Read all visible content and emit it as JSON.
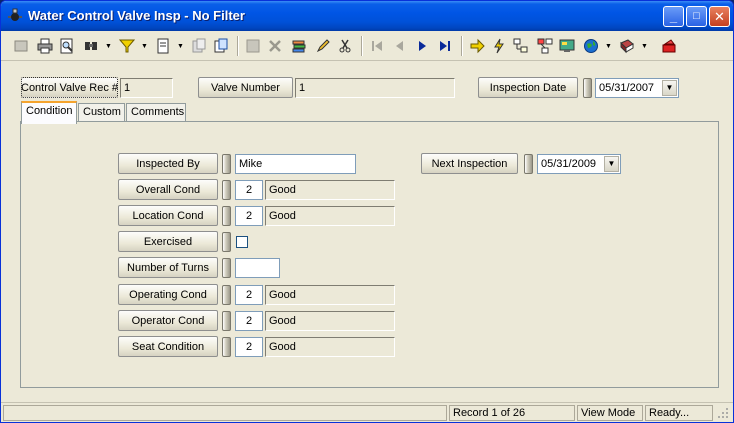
{
  "window": {
    "title": "Water Control Valve Insp - No Filter",
    "minimize": "_",
    "maximize": "□",
    "close": "✕"
  },
  "header": {
    "rec_label": "Control Valve Rec #",
    "rec_value": "1",
    "valve_label": "Valve Number",
    "valve_value": "1",
    "insp_date_label": "Inspection Date",
    "insp_date_value": "05/31/2007"
  },
  "tabs": [
    {
      "label": "Condition",
      "active": true
    },
    {
      "label": "Custom",
      "active": false
    },
    {
      "label": "Comments",
      "active": false
    }
  ],
  "condition": {
    "inspected_by_label": "Inspected By",
    "inspected_by_value": "Mike",
    "next_inspection_label": "Next Inspection",
    "next_inspection_value": "05/31/2009",
    "overall_label": "Overall Cond",
    "overall_code": "2",
    "overall_desc": "Good",
    "location_label": "Location Cond",
    "location_code": "2",
    "location_desc": "Good",
    "exercised_label": "Exercised",
    "exercised_checked": false,
    "turns_label": "Number of Turns",
    "turns_value": "",
    "operating_label": "Operating Cond",
    "operating_code": "2",
    "operating_desc": "Good",
    "operator_label": "Operator Cond",
    "operator_code": "2",
    "operator_desc": "Good",
    "seat_label": "Seat Condition",
    "seat_code": "2",
    "seat_desc": "Good"
  },
  "status": {
    "record": "Record 1 of 26",
    "mode": "View Mode",
    "state": "Ready..."
  },
  "colors": {
    "title_bar": "#0055e5",
    "window_bg": "#ece9d8",
    "tab_highlight": "#f5a42e"
  },
  "toolbar_icons": [
    "new-record-icon",
    "print-icon",
    "print-preview-icon",
    "find-icon",
    "filter-icon",
    "report-icon",
    "copy-record-icon",
    "duplicate-icon",
    "save-icon",
    "delete-icon",
    "layers-icon",
    "edit-icon",
    "cut-icon",
    "first-record-icon",
    "previous-record-icon",
    "next-record-icon",
    "last-record-icon",
    "goto-icon",
    "lightning-icon",
    "tree-icon",
    "diagram-icon",
    "monitor-icon",
    "globe-icon",
    "book-icon",
    "exit-icon"
  ]
}
